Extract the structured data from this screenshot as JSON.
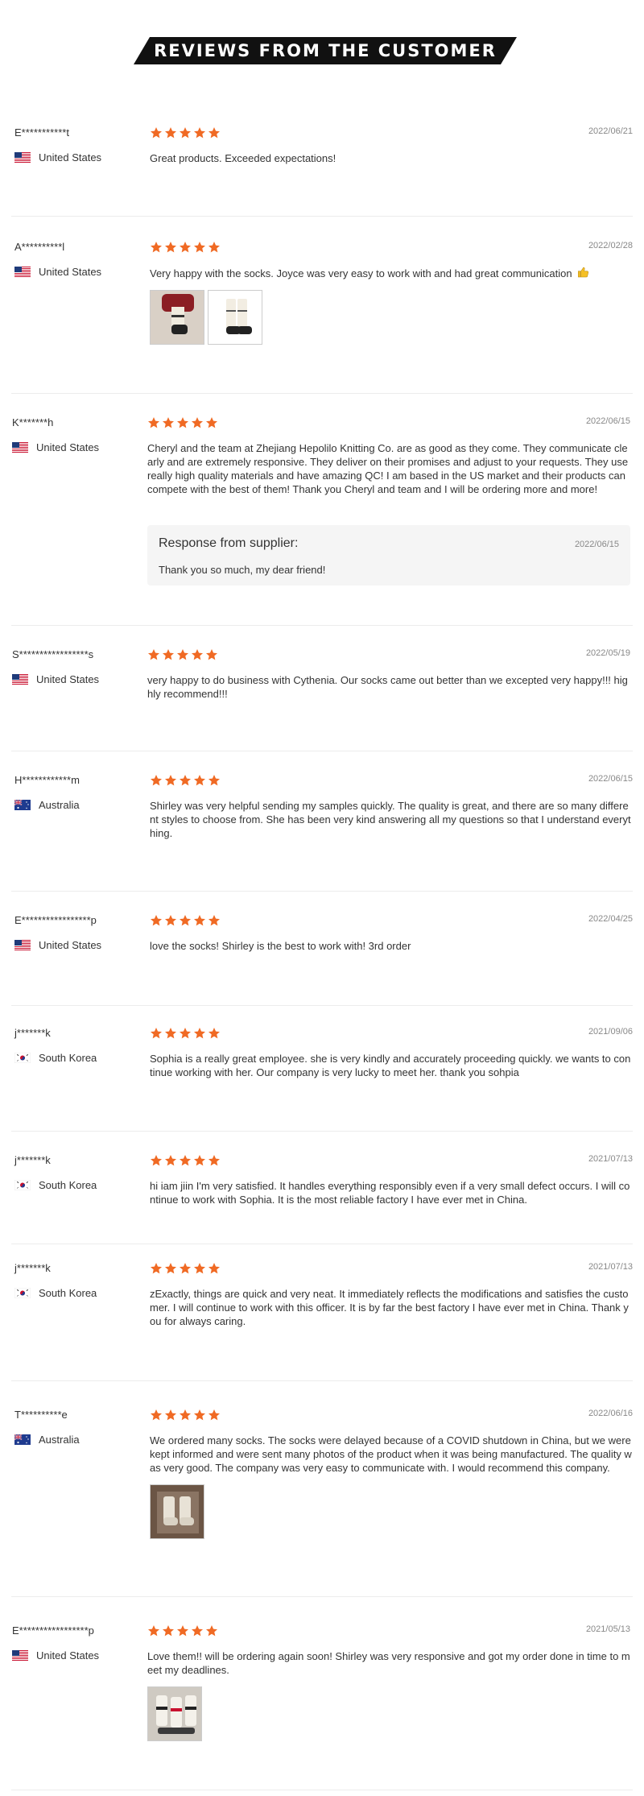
{
  "header": {
    "title": "REVIEWS FROM THE CUSTOMER"
  },
  "colors": {
    "star": "#f06a24",
    "banner": "#111111"
  },
  "reviews": [
    {
      "name": "E***********t",
      "country": "United States",
      "flag": "us",
      "date": "2022/06/21",
      "text": "Great products. Exceeded expectations!"
    },
    {
      "name": "A**********l",
      "country": "United States",
      "flag": "us",
      "date": "2022/02/28",
      "text": "Very happy with the socks. Joyce was very easy to work with and had great communication"
    },
    {
      "name": "K*******h",
      "country": "United States",
      "flag": "us",
      "date": "2022/06/15",
      "text": "Cheryl and the team at Zhejiang Hepolilo Knitting Co. are as good as they come. They communicate clearly and are extremely responsive. They deliver on their promises and adjust to your requests. They use really high quality materials and have amazing QC! I am based in the US market and their products can compete with the best of them! Thank you Cheryl and team and I will be ordering more and more!",
      "response": {
        "title": "Response from supplier:",
        "date": "2022/06/15",
        "text": "Thank you so much, my dear friend!"
      }
    },
    {
      "name": "S*****************s",
      "country": "United States",
      "flag": "us",
      "date": "2022/05/19",
      "text": "very happy to do business with Cythenia. Our socks came out better than we excepted very happy!!! highly recommend!!!"
    },
    {
      "name": "H************m",
      "country": "Australia",
      "flag": "au",
      "date": "2022/06/15",
      "text": "Shirley was very helpful sending my samples quickly. The quality is great, and there are so many different styles to choose from. She has been very kind answering all my questions so that I understand everything."
    },
    {
      "name": "E*****************p",
      "country": "United States",
      "flag": "us",
      "date": "2022/04/25",
      "text": "love the socks! Shirley is the best to work with! 3rd order"
    },
    {
      "name": "j*******k",
      "country": "South Korea",
      "flag": "kr",
      "date": "2021/09/06",
      "text": "Sophia is a really great employee. she is very kindly and accurately proceeding quickly. we wants to continue working with her. Our company is very lucky to meet her. thank you sohpia"
    },
    {
      "name": "j*******k",
      "country": "South Korea",
      "flag": "kr",
      "date": "2021/07/13",
      "text": "hi iam jiin I'm very satisfied. It handles everything responsibly even if a very small defect occurs. I will continue to work with Sophia. It is the most reliable factory I have ever met in China."
    },
    {
      "name": "j*******k",
      "country": "South Korea",
      "flag": "kr",
      "date": "2021/07/13",
      "text": "zExactly, things are quick and very neat. It immediately reflects the modifications and satisfies the customer. I will continue to work with this officer. It is by far the best factory I have ever met in China. Thank you for always caring."
    },
    {
      "name": "T**********e",
      "country": "Australia",
      "flag": "au",
      "date": "2022/06/16",
      "text": "We ordered many socks. The socks were delayed because of a COVID shutdown in China, but we were kept informed and were sent many photos of the product when it was being manufactured. The quality was very good. The company was very easy to communicate with. I would recommend this company."
    },
    {
      "name": "E*****************p",
      "country": "United States",
      "flag": "us",
      "date": "2021/05/13",
      "text": "Love them!! will be ordering again soon! Shirley was very responsive and got my order done in time to meet my deadlines."
    }
  ]
}
